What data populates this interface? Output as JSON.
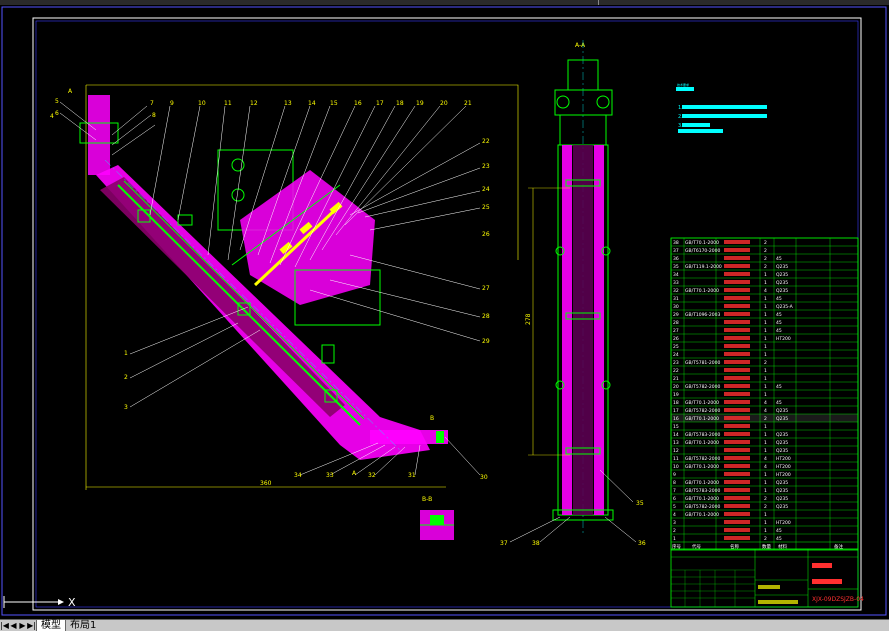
{
  "drawing": {
    "section_label_aa": "A-A",
    "section_label_bb": "B-B",
    "view_label_a": "A",
    "view_label_b": "B",
    "dim_vertical": "278",
    "dim_horizontal": "360",
    "part_numbers_top": [
      "5",
      "6",
      "7",
      "8",
      "9",
      "10",
      "11",
      "12",
      "13",
      "14",
      "15",
      "16",
      "17",
      "18",
      "19",
      "20",
      "21"
    ],
    "part_numbers_right": [
      "22",
      "23",
      "24",
      "25",
      "26",
      "27",
      "28",
      "29"
    ],
    "part_numbers_bottom": [
      "34",
      "33",
      "32",
      "31",
      "30"
    ],
    "part_numbers_left": [
      "1",
      "2",
      "3",
      "4"
    ],
    "part_numbers_side": [
      "35",
      "36",
      "37",
      "38"
    ]
  },
  "notes": {
    "title": "技术要求",
    "lines": [
      "1.",
      "2.",
      "3."
    ]
  },
  "bom": {
    "rows": [
      {
        "no": "38",
        "code": "GB/T70.1-2000",
        "name": "",
        "qty": "2",
        "mat": "",
        "rem": ""
      },
      {
        "no": "37",
        "code": "GB/T6170-2000",
        "name": "",
        "qty": "2",
        "mat": "",
        "rem": ""
      },
      {
        "no": "36",
        "code": "",
        "name": "",
        "qty": "2",
        "mat": "45",
        "rem": ""
      },
      {
        "no": "35",
        "code": "GB/T119.1-2000",
        "name": "",
        "qty": "2",
        "mat": "Q235",
        "rem": ""
      },
      {
        "no": "34",
        "code": "",
        "name": "",
        "qty": "1",
        "mat": "Q235",
        "rem": ""
      },
      {
        "no": "33",
        "code": "",
        "name": "",
        "qty": "1",
        "mat": "Q235",
        "rem": ""
      },
      {
        "no": "32",
        "code": "GB/T70.1-2000",
        "name": "",
        "qty": "4",
        "mat": "Q235",
        "rem": ""
      },
      {
        "no": "31",
        "code": "",
        "name": "",
        "qty": "1",
        "mat": "45",
        "rem": ""
      },
      {
        "no": "30",
        "code": "",
        "name": "",
        "qty": "1",
        "mat": "Q235-A",
        "rem": ""
      },
      {
        "no": "29",
        "code": "GB/T1096-2003",
        "name": "",
        "qty": "1",
        "mat": "45",
        "rem": ""
      },
      {
        "no": "28",
        "code": "",
        "name": "",
        "qty": "1",
        "mat": "45",
        "rem": ""
      },
      {
        "no": "27",
        "code": "",
        "name": "",
        "qty": "1",
        "mat": "45",
        "rem": ""
      },
      {
        "no": "26",
        "code": "",
        "name": "",
        "qty": "1",
        "mat": "HT200",
        "rem": ""
      },
      {
        "no": "25",
        "code": "",
        "name": "",
        "qty": "1",
        "mat": "",
        "rem": ""
      },
      {
        "no": "24",
        "code": "",
        "name": "",
        "qty": "1",
        "mat": "",
        "rem": ""
      },
      {
        "no": "23",
        "code": "GB/T5781-2000",
        "name": "",
        "qty": "2",
        "mat": "",
        "rem": ""
      },
      {
        "no": "22",
        "code": "",
        "name": "",
        "qty": "1",
        "mat": "",
        "rem": ""
      },
      {
        "no": "21",
        "code": "",
        "name": "",
        "qty": "1",
        "mat": "",
        "rem": ""
      },
      {
        "no": "20",
        "code": "GB/T5782-2000",
        "name": "",
        "qty": "1",
        "mat": "45",
        "rem": ""
      },
      {
        "no": "19",
        "code": "",
        "name": "",
        "qty": "1",
        "mat": "",
        "rem": ""
      },
      {
        "no": "18",
        "code": "GB/T70.1-2000",
        "name": "",
        "qty": "4",
        "mat": "45",
        "rem": ""
      },
      {
        "no": "17",
        "code": "GB/T5782-2000",
        "name": "",
        "qty": "4",
        "mat": "Q235",
        "rem": ""
      },
      {
        "no": "16",
        "code": "GB/T70.1-2000",
        "name": "",
        "qty": "2",
        "mat": "Q235",
        "rem": "",
        "highlight": true
      },
      {
        "no": "15",
        "code": "",
        "name": "",
        "qty": "1",
        "mat": "",
        "rem": ""
      },
      {
        "no": "14",
        "code": "GB/T5783-2000",
        "name": "",
        "qty": "1",
        "mat": "Q235",
        "rem": ""
      },
      {
        "no": "13",
        "code": "GB/T70.1-2000",
        "name": "",
        "qty": "1",
        "mat": "Q235",
        "rem": ""
      },
      {
        "no": "12",
        "code": "",
        "name": "",
        "qty": "1",
        "mat": "Q235",
        "rem": ""
      },
      {
        "no": "11",
        "code": "GB/T5782-2000",
        "name": "",
        "qty": "4",
        "mat": "HT200",
        "rem": ""
      },
      {
        "no": "10",
        "code": "GB/T70.1-2000",
        "name": "",
        "qty": "4",
        "mat": "HT200",
        "rem": ""
      },
      {
        "no": "9",
        "code": "",
        "name": "",
        "qty": "1",
        "mat": "HT200",
        "rem": ""
      },
      {
        "no": "8",
        "code": "GB/T70.1-2000",
        "name": "",
        "qty": "1",
        "mat": "Q235",
        "rem": ""
      },
      {
        "no": "7",
        "code": "GB/T5783-2000",
        "name": "",
        "qty": "1",
        "mat": "Q235",
        "rem": ""
      },
      {
        "no": "6",
        "code": "GB/T70.1-2000",
        "name": "",
        "qty": "2",
        "mat": "Q235",
        "rem": ""
      },
      {
        "no": "5",
        "code": "GB/T5782-2000",
        "name": "",
        "qty": "2",
        "mat": "Q235",
        "rem": ""
      },
      {
        "no": "4",
        "code": "GB/T70.1-2000",
        "name": "",
        "qty": "1",
        "mat": "",
        "rem": ""
      },
      {
        "no": "3",
        "code": "",
        "name": "",
        "qty": "1",
        "mat": "HT200",
        "rem": ""
      },
      {
        "no": "2",
        "code": "",
        "name": "",
        "qty": "1",
        "mat": "45",
        "rem": ""
      },
      {
        "no": "1",
        "code": "",
        "name": "",
        "qty": "2",
        "mat": "45",
        "rem": ""
      }
    ],
    "header": {
      "no": "序号",
      "code": "代号",
      "name": "名称",
      "qty": "数量",
      "mat": "材料",
      "rem": "备注"
    }
  },
  "title_block": {
    "drawing_no": "XJX-09DZSJZB-04",
    "school": "",
    "sheet": ""
  },
  "ucs": {
    "x_label": "X"
  },
  "tabs": {
    "nav_first": "|◀",
    "nav_prev": "◀",
    "nav_next": "▶",
    "nav_last": "▶|",
    "model": "模型",
    "layout1": "布局1"
  },
  "colors": {
    "frame": "#3a3aff",
    "hatch": "#ff00ff",
    "outline": "#00ff00",
    "leader": "#ffff00",
    "text": "#ff3030",
    "center": "#00ffff",
    "dim": "#ffff00",
    "table": "#00ff00"
  }
}
